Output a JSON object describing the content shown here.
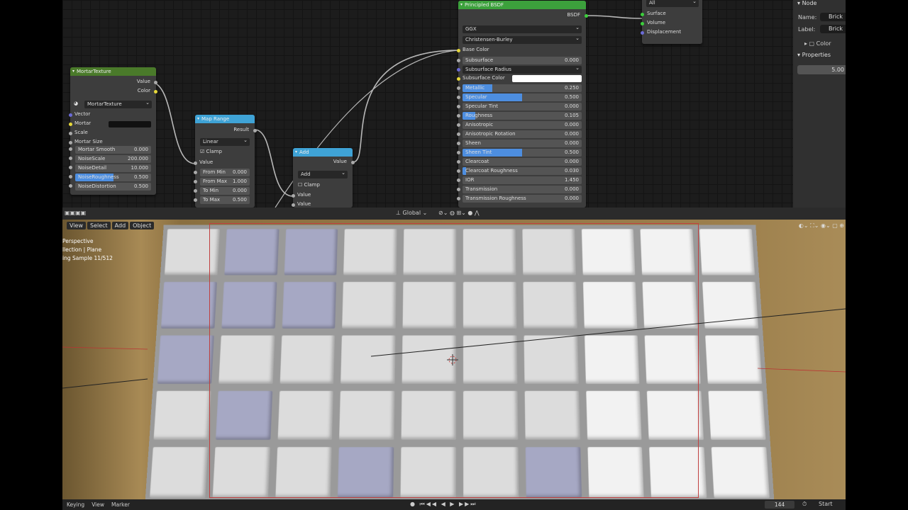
{
  "node_editor": {
    "mortar": {
      "title": "MortarTexture",
      "outputs": [
        "Value",
        "Color"
      ],
      "datablock": "MortarTexture",
      "inputs": [
        "Vector",
        "Mortar",
        "Scale",
        "Mortar Size"
      ],
      "fields": [
        {
          "label": "Mortar Smooth",
          "value": "0.000",
          "fill": 0
        },
        {
          "label": "NoiseScale",
          "value": "200.000",
          "fill": 0
        },
        {
          "label": "NoiseDetail",
          "value": "10.000",
          "fill": 0
        },
        {
          "label": "NoiseRoughness",
          "value": "0.500",
          "fill": 0.5
        },
        {
          "label": "NoiseDistortion",
          "value": "0.500",
          "fill": 0
        }
      ]
    },
    "map_range": {
      "title": "Map Range",
      "output": "Result",
      "mode": "Linear",
      "clamp": "Clamp",
      "input": "Value",
      "fields": [
        {
          "label": "From Min",
          "value": "0.000"
        },
        {
          "label": "From Max",
          "value": "1.000"
        },
        {
          "label": "To Min",
          "value": "0.000"
        },
        {
          "label": "To Max",
          "value": "0.500"
        }
      ]
    },
    "add": {
      "title": "Add",
      "output": "Value",
      "op": "Add",
      "clamp": "Clamp",
      "inputs": [
        "Value",
        "Value"
      ]
    },
    "principled": {
      "title": "Principled BSDF",
      "output": "BSDF",
      "distribution": "GGX",
      "subsurface_method": "Christensen-Burley",
      "base_color": "Base Color",
      "subsurface_radius": "Subsurface Radius",
      "subsurface_color": "Subsurface Color",
      "fields": [
        {
          "label": "Subsurface",
          "value": "0.000",
          "fill": 0
        },
        {
          "label": "Metallic",
          "value": "0.250",
          "fill": 0.25
        },
        {
          "label": "Specular",
          "value": "0.500",
          "fill": 0.5
        },
        {
          "label": "Specular Tint",
          "value": "0.000",
          "fill": 0
        },
        {
          "label": "Roughness",
          "value": "0.105",
          "fill": 0.105
        },
        {
          "label": "Anisotropic",
          "value": "0.000",
          "fill": 0
        },
        {
          "label": "Anisotropic Rotation",
          "value": "0.000",
          "fill": 0
        },
        {
          "label": "Sheen",
          "value": "0.000",
          "fill": 0
        },
        {
          "label": "Sheen Tint",
          "value": "0.500",
          "fill": 0.5
        },
        {
          "label": "Clearcoat",
          "value": "0.000",
          "fill": 0
        },
        {
          "label": "Clearcoat Roughness",
          "value": "0.030",
          "fill": 0.03
        },
        {
          "label": "IOR",
          "value": "1.450",
          "fill": 0
        },
        {
          "label": "Transmission",
          "value": "0.000",
          "fill": 0
        },
        {
          "label": "Transmission Roughness",
          "value": "0.000",
          "fill": 0
        }
      ]
    },
    "output": {
      "target": "All",
      "inputs": [
        "Surface",
        "Volume",
        "Displacement"
      ]
    }
  },
  "sidebar": {
    "node_header": "Node",
    "name_label": "Name:",
    "name_value": "Brick",
    "label_label": "Label:",
    "label_value": "Brick",
    "color": "Color",
    "properties": "Properties",
    "prop_value": "5.00"
  },
  "viewport": {
    "menus": [
      "View",
      "Select",
      "Add",
      "Object"
    ],
    "orientation": "Global",
    "info": [
      "Perspective",
      "llection | Plane",
      "ing Sample 11/512"
    ]
  },
  "timeline": {
    "menus": [
      "Keying",
      "View",
      "Marker"
    ],
    "frame": "144",
    "start_label": "Start"
  },
  "colors": {
    "header_green": "#4a7a2a",
    "header_blue": "#3fa3d6",
    "bsdf_green": "#3ca13c",
    "accent": "#4d8ee0"
  }
}
